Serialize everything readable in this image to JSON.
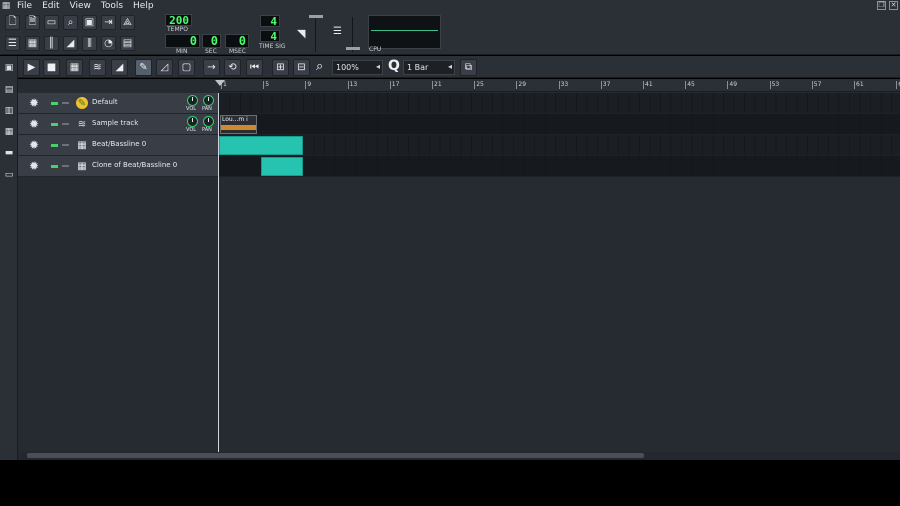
{
  "menubar": {
    "items": [
      "File",
      "Edit",
      "View",
      "Tools",
      "Help"
    ]
  },
  "transport": {
    "tempo": "200",
    "tempo_label": "TEMPO",
    "time_min": "0",
    "time_sec": "0",
    "time_msec": "0",
    "min_label": "MIN",
    "sec_label": "SEC",
    "msec_label": "MSEC",
    "timesig_num": "4",
    "timesig_den": "4",
    "timesig_label": "TIME SIG",
    "cpu_label": "CPU"
  },
  "toolbar": {
    "zoom": "100%",
    "quantize": "1 Bar"
  },
  "ruler": {
    "ticks": [
      "1",
      "5",
      "9",
      "13",
      "17",
      "21",
      "25",
      "29",
      "33",
      "37",
      "41",
      "45",
      "49",
      "53",
      "57",
      "61",
      "6"
    ]
  },
  "tracks": [
    {
      "name": "Default",
      "icon": "instrument-icon",
      "has_knobs": true
    },
    {
      "name": "Sample track",
      "icon": "waveform-icon",
      "has_knobs": true,
      "clip_label": "Lou...m i"
    },
    {
      "name": "Beat/Bassline 0",
      "icon": "grid-icon",
      "has_knobs": false
    },
    {
      "name": "Clone of Beat/Bassline 0",
      "icon": "grid-icon",
      "has_knobs": false
    }
  ],
  "knob_labels": {
    "vol": "VOL",
    "pan": "PAN"
  },
  "colors": {
    "bg": "#262a31",
    "panel": "#2b2f36",
    "lcd_green": "#4cff6a",
    "clip_teal": "#25c3b0",
    "sample_orange": "#d08a2e"
  }
}
